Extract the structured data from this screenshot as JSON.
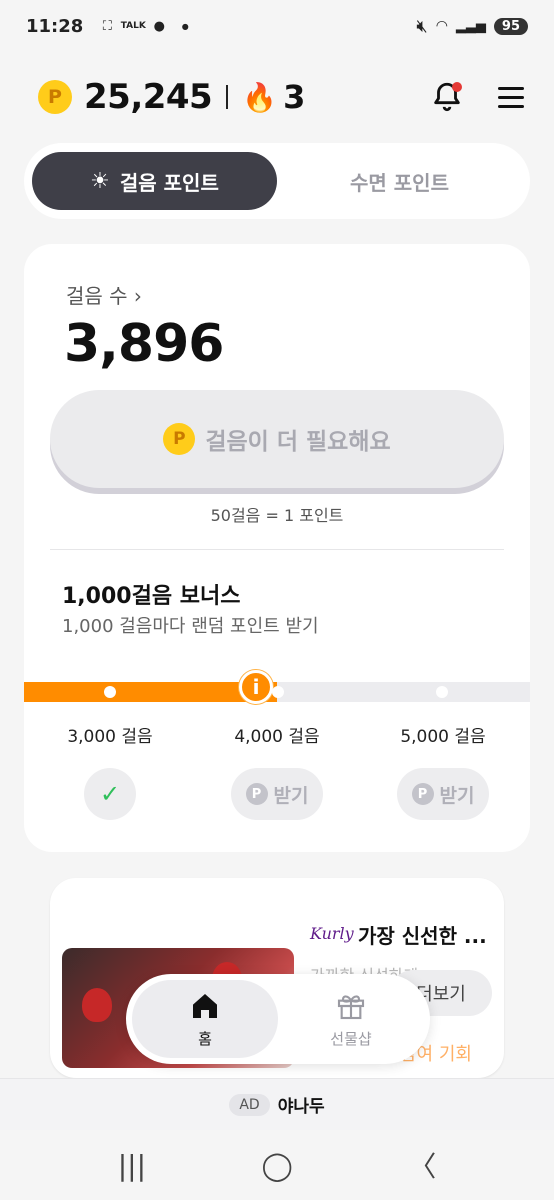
{
  "status_bar": {
    "time": "11:28",
    "battery": "95",
    "talk": "TALK"
  },
  "header": {
    "point_coin_letter": "P",
    "points": "25,245",
    "streak": "3"
  },
  "tabs": [
    {
      "label": "걸음 포인트",
      "active": true
    },
    {
      "label": "수면 포인트",
      "active": false
    }
  ],
  "steps": {
    "label": "걸음 수",
    "value": "3,896",
    "need_button": "걸음이 더 필요해요",
    "rate": "50걸음 = 1 포인트"
  },
  "bonus": {
    "title": "1,000걸음 보너스",
    "subtitle": "1,000 걸음마다 랜덤 포인트 받기",
    "progress_fraction": 0.5,
    "milestones": [
      {
        "label": "3,000 걸음",
        "state": "done",
        "button": ""
      },
      {
        "label": "4,000 걸음",
        "state": "locked",
        "button": "받기"
      },
      {
        "label": "5,000 걸음",
        "state": "locked",
        "button": "받기"
      }
    ]
  },
  "ad_card": {
    "brand": "Kurly",
    "title": "가장 신선한 ...",
    "subtitle": "가까한 신선하게 ...",
    "more_button": "더보기",
    "join_text": "참여 기회"
  },
  "bottom_nav": [
    {
      "label": "홈",
      "icon": "home-icon",
      "active": true
    },
    {
      "label": "선물샵",
      "icon": "gift-icon",
      "active": false
    }
  ],
  "banner": {
    "badge": "AD",
    "name": "야나두"
  },
  "colors": {
    "accent": "#ff8c00",
    "coin": "#ffcc1a",
    "dark_tab": "#3f3f48"
  }
}
